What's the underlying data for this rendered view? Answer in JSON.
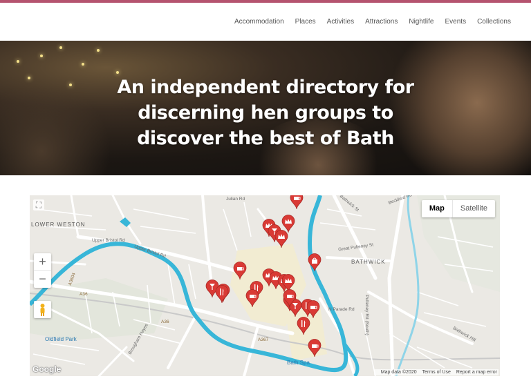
{
  "nav": {
    "items": [
      "Accommodation",
      "Places",
      "Activities",
      "Attractions",
      "Nightlife",
      "Events",
      "Collections"
    ]
  },
  "hero": {
    "line1": "An independent directory for",
    "line2": "discerning hen groups to",
    "line3": "discover the best of Bath"
  },
  "map": {
    "type_map": "Map",
    "type_satellite": "Satellite",
    "zoom_in": "+",
    "zoom_out": "−",
    "google": "Google",
    "map_data": "Map data ©2020",
    "terms": "Terms of Use",
    "report": "Report a map error",
    "areas": {
      "lower_weston": "LOWER WESTON",
      "bathwick": "BATHWICK",
      "oldfield_park": "Oldfield Park",
      "bath_spa": "Bath Spa"
    },
    "streets": {
      "upper_bristol": "Upper Bristol Rd",
      "upper_bristol2": "Upper Bristol Rd",
      "julian": "Julian Rd",
      "bathwick_st": "Bathwick St",
      "beckford": "Beckford Rd",
      "pulteney": "Pulteney Rd (South)",
      "bathwick_hill": "Bathwick Hill",
      "a36": "A36",
      "a36b": "A36",
      "a367": "A367",
      "a3604": "A3604",
      "brougham": "Brougham Hayes",
      "great_pulteney": "Great Pulteney St",
      "n_parade": "N Parade Rd"
    },
    "colors": {
      "river": "#38b6d8",
      "pin": "#d93a35"
    },
    "pins": [
      "cup-icon",
      "crown-icon",
      "crown-icon",
      "drink-icon",
      "crown-icon",
      "shop-icon",
      "cup-icon",
      "crown-icon",
      "crown-icon",
      "crown-icon",
      "drink-icon",
      "drink-icon",
      "cutlery-icon",
      "cup-icon",
      "crown-icon",
      "drink-icon",
      "drink-icon",
      "cutlery-icon",
      "cup-icon",
      "cutlery-icon",
      "cup-icon",
      "cutlery-icon",
      "cup-icon"
    ]
  }
}
